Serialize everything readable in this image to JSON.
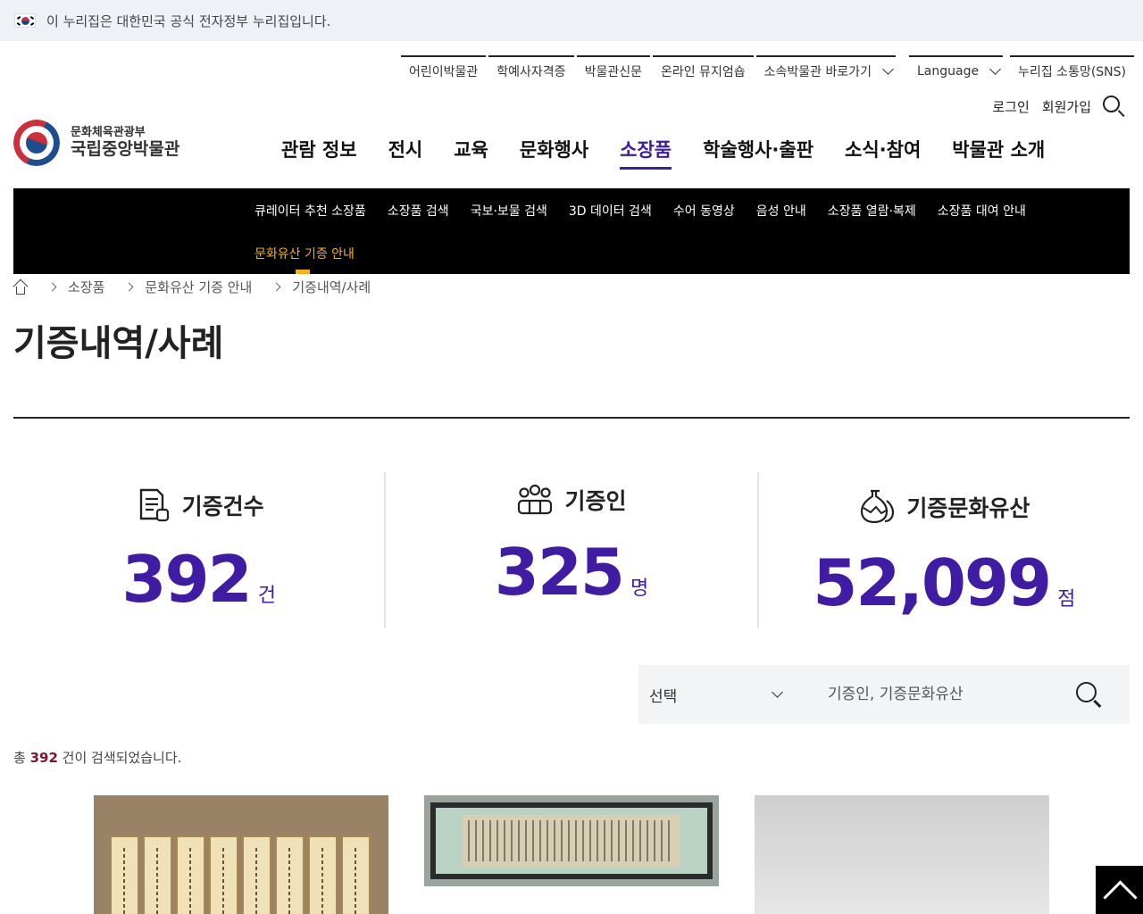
{
  "notice": {
    "text": "이 누리집은 대한민국 공식 전자정부 누리집입니다."
  },
  "util": {
    "links": [
      "어린이박물관",
      "학예사자격증",
      "박물관신문",
      "온라인 뮤지엄숍",
      "소속박물관 바로가기"
    ],
    "language": "Language",
    "sns": "누리집 소통망(SNS)"
  },
  "account": {
    "login": "로그인",
    "signup": "회원가입"
  },
  "logo": {
    "line1": "문화체육관광부",
    "line2": "국립중앙박물관"
  },
  "gnb": [
    "관람 정보",
    "전시",
    "교육",
    "문화행사",
    "소장품",
    "학술행사·출판",
    "소식·참여",
    "박물관 소개"
  ],
  "subnav": {
    "row1": [
      "큐레이터 추천 소장품",
      "소장품 검색",
      "국보·보물 검색",
      "3D 데이터 검색",
      "수어 동영상",
      "음성 안내",
      "소장품 열람·복제",
      "소장품 대여 안내"
    ],
    "row2": [
      "문화유산 기증 안내"
    ]
  },
  "breadcrumb": [
    "소장품",
    "문화유산 기증 안내",
    "기증내역/사례"
  ],
  "page_title": "기증내역/사례",
  "stats": [
    {
      "label": "기증건수",
      "value": "392",
      "unit": "건",
      "icon": "document-icon"
    },
    {
      "label": "기증인",
      "value": "325",
      "unit": "명",
      "icon": "people-icon"
    },
    {
      "label": "기증문화유산",
      "value": "52,099",
      "unit": "점",
      "icon": "vase-icon"
    }
  ],
  "search": {
    "select_value": "선택",
    "placeholder": "기증인, 기증문화유산"
  },
  "result": {
    "prefix": "총 ",
    "count": "392",
    "suffix": " 건이 검색되었습니다."
  },
  "colors": {
    "accent": "#3f1ca3",
    "highlight": "#f6b318",
    "count": "#7b1730"
  }
}
